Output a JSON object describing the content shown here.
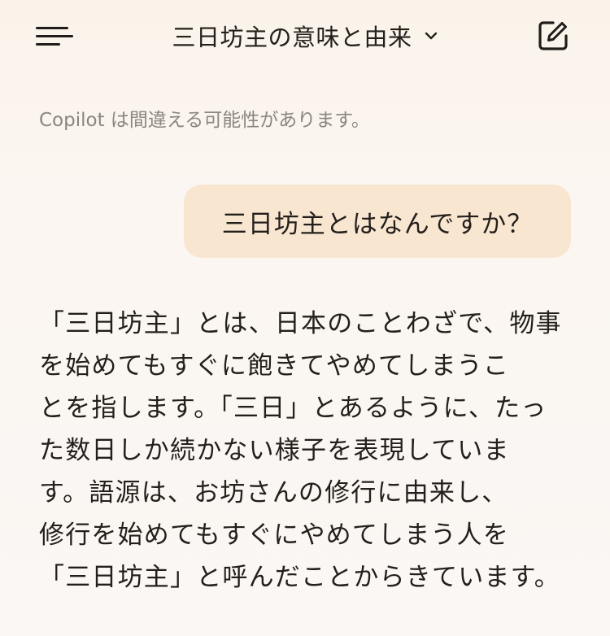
{
  "header": {
    "title": "三日坊主の意味と由来",
    "menu_icon": "hamburger-menu-icon",
    "chevron_icon": "chevron-down-icon",
    "compose_icon": "new-chat-icon"
  },
  "disclaimer": "Copilot は間違える可能性があります。",
  "messages": {
    "user": "三日坊主とはなんですか？",
    "assistant_lines": [
      "「三日坊主」とは、日本のことわざで、物事",
      "を始めてもすぐに飽きてやめてしまうこ",
      "とを指します。「三日」とあるように、たっ",
      "た数日しか続かない様子を表現していま",
      "す。語源は、お坊さんの修行に由来し、",
      "修行を始めてもすぐにやめてしまう人を",
      "「三日坊主」と呼んだことからきています。"
    ]
  },
  "colors": {
    "background": "#faf7f4",
    "user_bubble": "#f9e6d1",
    "text": "#231f1b",
    "muted_text": "#8c8680"
  }
}
